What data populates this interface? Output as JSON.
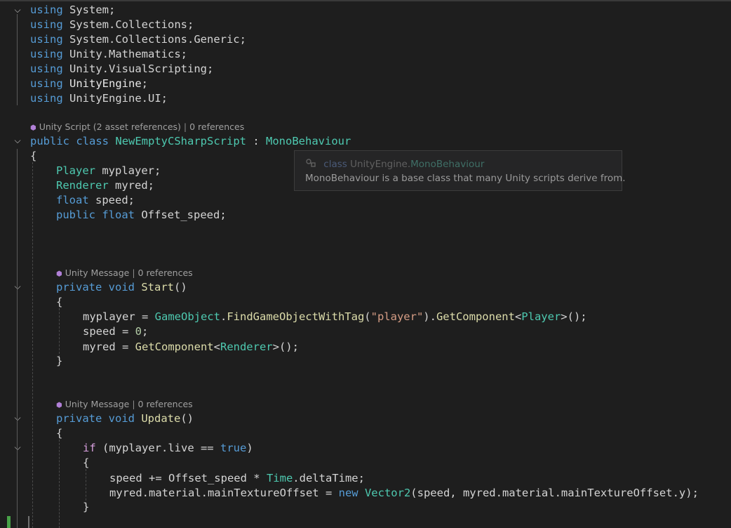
{
  "usings": [
    {
      "kw": "using",
      "ns": "System",
      "end": ";"
    },
    {
      "kw": "using",
      "ns": "System.Collections",
      "end": ";"
    },
    {
      "kw": "using",
      "ns": "System.Collections.Generic",
      "end": ";"
    },
    {
      "kw": "using",
      "ns": "Unity.Mathematics",
      "end": ";"
    },
    {
      "kw": "using",
      "ns": "Unity.VisualScripting",
      "end": ";"
    },
    {
      "kw": "using",
      "ns": "UnityEngine",
      "end": ";"
    },
    {
      "kw": "using",
      "ns": "UnityEngine.UI",
      "end": ";"
    }
  ],
  "class_lens": {
    "label": "Unity Script (2 asset references)",
    "sep": " | ",
    "refs": "0 references"
  },
  "class_decl": {
    "kw1": "public",
    "kw2": "class",
    "name": "NewEmptyCSharpScript",
    "colon": " : ",
    "base": "MonoBehaviour"
  },
  "brace_open": "{",
  "brace_close": "}",
  "fields": [
    {
      "type": "Player",
      "name": " myplayer;"
    },
    {
      "type": "Renderer",
      "name": " myred;"
    },
    {
      "type": "float",
      "name": " speed;"
    },
    {
      "mod": "public",
      "type": "float",
      "name": " Offset_speed;"
    }
  ],
  "start_lens": {
    "label": "Unity Message",
    "sep": " | ",
    "refs": "0 references"
  },
  "start_decl": {
    "kw1": "private",
    "kw2": "void",
    "name": "Start",
    "parens": "()"
  },
  "start_body": {
    "l1": {
      "a": "myplayer = ",
      "ty": "GameObject",
      "dot": ".",
      "fn": "FindGameObjectWithTag",
      "p1": "(",
      "str": "\"player\"",
      "p2": ").",
      "fn2": "GetComponent",
      "lt": "<",
      "ty2": "Player",
      "gt": ">();"
    },
    "l2": {
      "a": "speed = ",
      "num": "0",
      "end": ";"
    },
    "l3": {
      "a": "myred = ",
      "fn": "GetComponent",
      "lt": "<",
      "ty": "Renderer",
      "gt": ">();"
    }
  },
  "update_lens": {
    "label": "Unity Message",
    "sep": " | ",
    "refs": "0 references"
  },
  "update_decl": {
    "kw1": "private",
    "kw2": "void",
    "name": "Update",
    "parens": "()"
  },
  "update_body": {
    "if": {
      "kw": "if",
      "a": " (myplayer.live == ",
      "val": "true",
      "b": ")"
    },
    "l1": {
      "a": "speed += Offset_speed * ",
      "ty": "Time",
      "b": ".deltaTime;"
    },
    "l2": {
      "a": "myred.material.mainTextureOffset = ",
      "kw": "new",
      "sp": " ",
      "ty": "Vector2",
      "b": "(speed, myred.material.mainTextureOffset.y);"
    }
  },
  "tooltip": {
    "kw": "class",
    "ns": "UnityEngine.",
    "type": "MonoBehaviour",
    "desc": "MonoBehaviour is a base class that many Unity scripts derive from."
  },
  "icons": {
    "fold": "chevron-down-icon",
    "lens": "unity-cube-icon",
    "tooltip": "class-symbol-icon"
  }
}
